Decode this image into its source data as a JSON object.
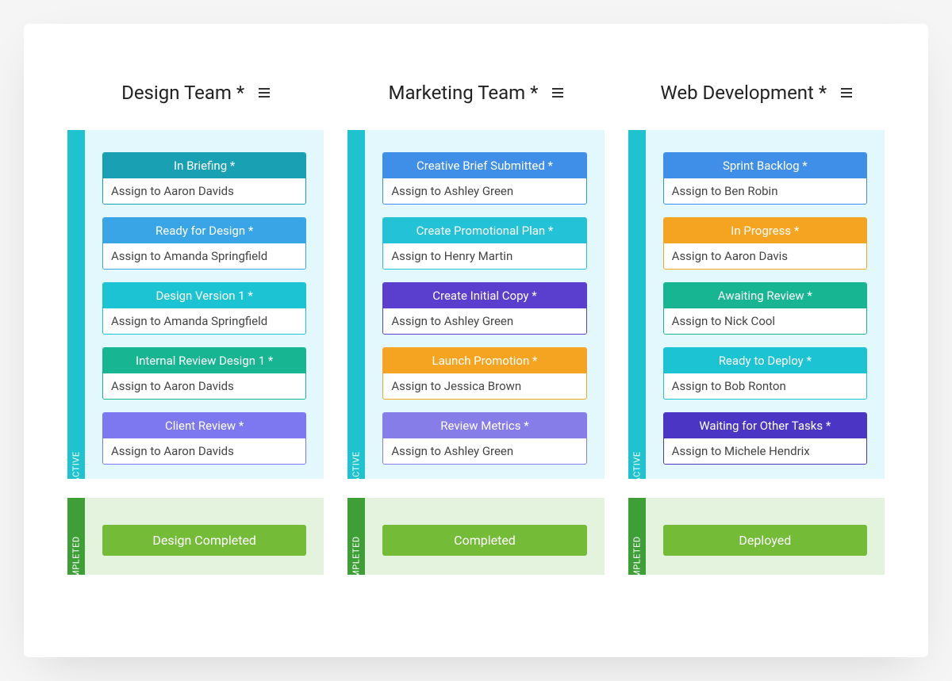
{
  "labels": {
    "active": "ACTIVE",
    "completed": "COMPLETED"
  },
  "columns": [
    {
      "title": "Design Team *",
      "completed_label": "Design Completed",
      "tasks": [
        {
          "title": "In Briefing *",
          "assign": "Assign to Aaron Davids",
          "color": "teal-dark"
        },
        {
          "title": "Ready for Design *",
          "assign": "Assign to Amanda Springfield",
          "color": "blue-light"
        },
        {
          "title": "Design Version 1 *",
          "assign": "Assign to Amanda Springfield",
          "color": "cyan"
        },
        {
          "title": "Internal Review Design 1 *",
          "assign": "Assign to Aaron Davids",
          "color": "teal-green"
        },
        {
          "title": "Client Review *",
          "assign": "Assign to Aaron Davids",
          "color": "purple-lt"
        }
      ]
    },
    {
      "title": "Marketing Team *",
      "completed_label": "Completed",
      "tasks": [
        {
          "title": "Creative Brief Submitted *",
          "assign": "Assign to Ashley Green",
          "color": "blue"
        },
        {
          "title": "Create Promotional Plan *",
          "assign": "Assign to Henry Martin",
          "color": "turquoise"
        },
        {
          "title": "Create Initial Copy *",
          "assign": "Assign to Ashley Green",
          "color": "indigo"
        },
        {
          "title": "Launch Promotion *",
          "assign": "Assign to Jessica Brown",
          "color": "orange"
        },
        {
          "title": "Review Metrics *",
          "assign": "Assign to Ashley Green",
          "color": "violet"
        }
      ]
    },
    {
      "title": "Web Development *",
      "completed_label": "Deployed",
      "tasks": [
        {
          "title": "Sprint Backlog *",
          "assign": "Assign to Ben Robin",
          "color": "blue"
        },
        {
          "title": "In Progress *",
          "assign": "Assign to Aaron Davis",
          "color": "orange"
        },
        {
          "title": "Awaiting Review *",
          "assign": "Assign to Nick Cool",
          "color": "teal-green"
        },
        {
          "title": "Ready to Deploy *",
          "assign": "Assign to Bob Ronton",
          "color": "cyan"
        },
        {
          "title": "Waiting for Other Tasks *",
          "assign": "Assign to Michele Hendrix",
          "color": "indigo-dark"
        }
      ]
    }
  ]
}
